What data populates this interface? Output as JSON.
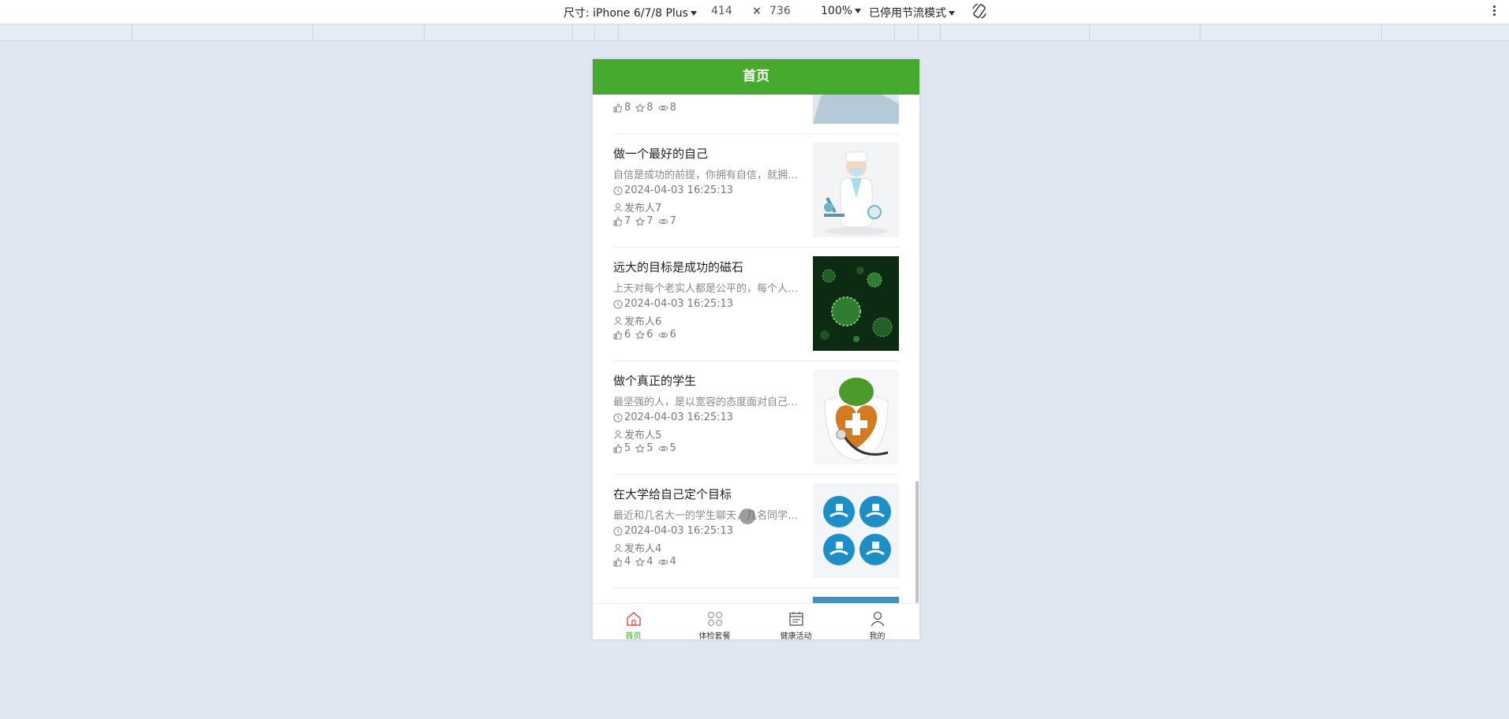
{
  "devtools": {
    "size_label": "尺寸: iPhone 6/7/8 Plus",
    "width": "414",
    "times": "×",
    "height": "736",
    "zoom": "100%",
    "throttle": "已停用节流模式"
  },
  "header": {
    "title": "首页"
  },
  "partial_top": {
    "likes": "8",
    "favorites": "8",
    "views": "8"
  },
  "articles": [
    {
      "title": "做一个最好的自己",
      "desc": "自信是成功的前提，你拥有自信，就拥有成功的一半",
      "time": "2024-04-03 16:25:13",
      "author": "发布人7",
      "likes": "7",
      "favorites": "7",
      "views": "7",
      "thumb": "doctor-microscope"
    },
    {
      "title": "远大的目标是成功的磁石",
      "desc": "上天对每个老实人都是公平的，每个人每天都有",
      "time": "2024-04-03 16:25:13",
      "author": "发布人6",
      "likes": "6",
      "favorites": "6",
      "views": "6",
      "thumb": "green-virus"
    },
    {
      "title": "做个真正的学生",
      "desc": "最坚强的人，是以宽容的态度面对自己缺点的人",
      "time": "2024-04-03 16:25:13",
      "author": "发布人5",
      "likes": "5",
      "favorites": "5",
      "views": "5",
      "thumb": "heart-stethoscope"
    },
    {
      "title": "在大学给自己定个目标",
      "desc": "最近和几名大一的学生聊天，几名同学认为大学",
      "time": "2024-04-03 16:25:13",
      "author": "发布人4",
      "likes": "4",
      "favorites": "4",
      "views": "4",
      "thumb": "blue-medical-icons"
    }
  ],
  "tabs": [
    {
      "label": "首页",
      "icon": "home-icon",
      "active": true
    },
    {
      "label": "体检套餐",
      "icon": "grid-icon",
      "active": false
    },
    {
      "label": "健康活动",
      "icon": "calendar-icon",
      "active": false
    },
    {
      "label": "我的",
      "icon": "user-icon",
      "active": false
    }
  ],
  "colors": {
    "brand": "#45aa2d",
    "background": "#dfe7f3"
  }
}
